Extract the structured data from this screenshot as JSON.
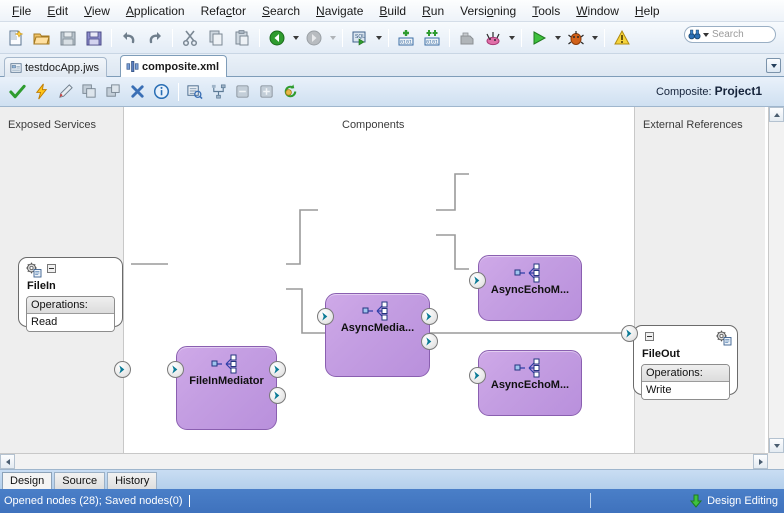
{
  "menubar": {
    "items": [
      {
        "label": "File",
        "mnemonic": "F"
      },
      {
        "label": "Edit",
        "mnemonic": "E"
      },
      {
        "label": "View",
        "mnemonic": "V"
      },
      {
        "label": "Application",
        "mnemonic": "A"
      },
      {
        "label": "Refactor",
        "mnemonic": "c"
      },
      {
        "label": "Search",
        "mnemonic": "S"
      },
      {
        "label": "Navigate",
        "mnemonic": "N"
      },
      {
        "label": "Build",
        "mnemonic": "B"
      },
      {
        "label": "Run",
        "mnemonic": "R"
      },
      {
        "label": "Versioning",
        "mnemonic": "o"
      },
      {
        "label": "Tools",
        "mnemonic": "T"
      },
      {
        "label": "Window",
        "mnemonic": "W"
      },
      {
        "label": "Help",
        "mnemonic": "H"
      }
    ]
  },
  "toolbar": {
    "buttons": [
      {
        "name": "new-icon",
        "title": "New"
      },
      {
        "name": "open-icon",
        "title": "Open"
      },
      {
        "name": "save-icon",
        "title": "Save"
      },
      {
        "name": "save-all-icon",
        "title": "Save All"
      },
      {
        "name": "undo-icon",
        "title": "Undo"
      },
      {
        "name": "redo-icon",
        "title": "Redo"
      },
      {
        "name": "cut-icon",
        "title": "Cut"
      },
      {
        "name": "copy-icon",
        "title": "Copy"
      },
      {
        "name": "paste-icon",
        "title": "Paste"
      },
      {
        "name": "back-icon",
        "title": "Back"
      },
      {
        "name": "forward-icon",
        "title": "Forward"
      },
      {
        "name": "run-sql-icon",
        "title": "Run SQL"
      },
      {
        "name": "add-breakpoint-icon",
        "title": "Add Breakpoint"
      },
      {
        "name": "toggle-breakpoints-icon",
        "title": "Toggle Breakpoints"
      },
      {
        "name": "deploy-icon",
        "title": "Deploy"
      },
      {
        "name": "profile-icon",
        "title": "Profile"
      },
      {
        "name": "run-icon",
        "title": "Run"
      },
      {
        "name": "debug-icon",
        "title": "Debug"
      },
      {
        "name": "warning-icon",
        "title": "Warnings"
      }
    ],
    "search_placeholder": "Search"
  },
  "file_tabs": [
    {
      "label": "testdocApp.jws",
      "icon": "application-icon",
      "active": false
    },
    {
      "label": "composite.xml",
      "icon": "composite-icon",
      "active": true
    }
  ],
  "editor_toolbar": {
    "buttons": [
      {
        "name": "validate-icon",
        "title": "Validate"
      },
      {
        "name": "quick-fix-icon",
        "title": "Quick Fix"
      },
      {
        "name": "edit-icon",
        "title": "Edit"
      },
      {
        "name": "copy-node-icon",
        "title": "Copy"
      },
      {
        "name": "duplicate-node-icon",
        "title": "Duplicate"
      },
      {
        "name": "delete-icon",
        "title": "Delete"
      },
      {
        "name": "info-icon",
        "title": "Info"
      },
      {
        "name": "properties-icon",
        "title": "Properties"
      },
      {
        "name": "layout-icon",
        "title": "Auto Layout"
      },
      {
        "name": "zoom-out-icon",
        "title": "Zoom Out"
      },
      {
        "name": "zoom-in-icon",
        "title": "Zoom In"
      },
      {
        "name": "refresh-icon",
        "title": "Refresh"
      }
    ],
    "composite_prefix": "Composite:",
    "composite_name": "Project1"
  },
  "canvas": {
    "lanes": [
      {
        "title": "Exposed Services"
      },
      {
        "title": "Components"
      },
      {
        "title": "External References"
      }
    ],
    "services": [
      {
        "name": "FileIn",
        "ops_header": "Operations:",
        "ops": [
          "Read"
        ],
        "gear_side": "left"
      }
    ],
    "components": [
      {
        "name": "FileInMediator",
        "outputs": 2,
        "inputs": 1
      },
      {
        "name": "AsyncMedia...",
        "outputs": 2,
        "inputs": 1
      },
      {
        "name": "AsyncEchoM...",
        "outputs": 0,
        "inputs": 1
      },
      {
        "name": "AsyncEchoM...",
        "outputs": 0,
        "inputs": 1
      }
    ],
    "references": [
      {
        "name": "FileOut",
        "ops_header": "Operations:",
        "ops": [
          "Write"
        ],
        "gear_side": "right"
      }
    ]
  },
  "bottom_tabs": [
    {
      "label": "Design",
      "active": true
    },
    {
      "label": "Source",
      "active": false
    },
    {
      "label": "History",
      "active": false
    }
  ],
  "statusbar": {
    "left_text": "Opened nodes (28); Saved nodes(0)",
    "right_text": "Design Editing",
    "right_icon": "design-editing-icon"
  },
  "colors": {
    "component_fill": "#c49ee2",
    "component_border": "#8a5fb0",
    "connector_chevron": "#0a7a96",
    "status_bg": "#4a7fc8",
    "lane_bg": "#eeeeee",
    "link_line": "#9a9a9a"
  }
}
